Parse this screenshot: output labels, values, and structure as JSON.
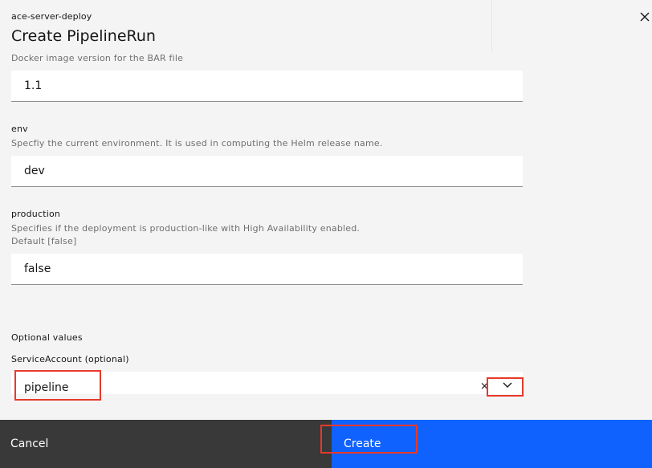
{
  "header": {
    "subtitle": "ace-server-deploy",
    "title": "Create PipelineRun"
  },
  "fields": {
    "image_version": {
      "helper": "Docker image version for the BAR file",
      "value": "1.1"
    },
    "env": {
      "label": "env",
      "helper": "Specfiy the current environment. It is used in computing the Helm release name.",
      "value": "dev"
    },
    "production": {
      "label": "production",
      "helper_line1": "Specifies if the deployment is production-like with High Availability enabled.",
      "helper_line2": "Default [false]",
      "value": "false"
    }
  },
  "optional": {
    "section_label": "Optional values",
    "service_account_label": "ServiceAccount (optional)",
    "service_account_value": "pipeline",
    "clear_glyph": "×"
  },
  "footer": {
    "cancel_label": "Cancel",
    "create_label": "Create"
  },
  "colors": {
    "primary": "#0f62fe",
    "secondary": "#393939",
    "highlight": "#e8392a"
  }
}
